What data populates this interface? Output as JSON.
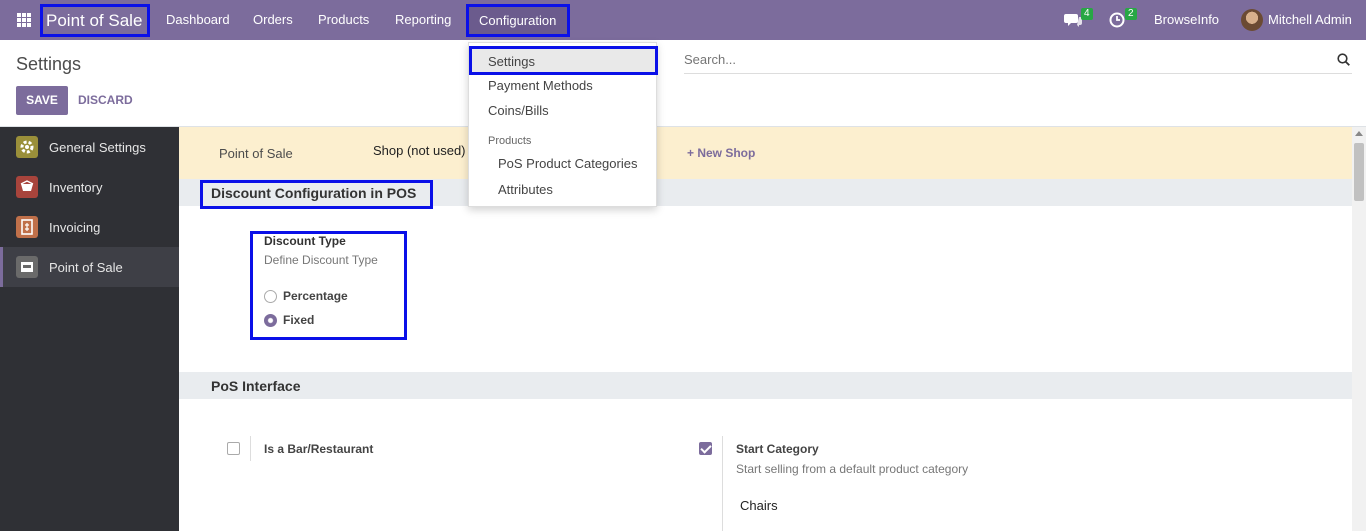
{
  "navbar": {
    "brand": "Point of Sale",
    "menu": [
      "Dashboard",
      "Orders",
      "Products",
      "Reporting"
    ],
    "active_menu": "Configuration",
    "chat_count": "4",
    "activity_count": "2",
    "company": "BrowseInfo",
    "user": "Mitchell Admin"
  },
  "control_panel": {
    "title": "Settings",
    "save_label": "SAVE",
    "discard_label": "DISCARD",
    "search_placeholder": "Search..."
  },
  "sidebar": {
    "items": [
      {
        "label": "General Settings",
        "color": "#9a8f3a"
      },
      {
        "label": "Inventory",
        "color": "#a8443c"
      },
      {
        "label": "Invoicing",
        "color": "#c0704a"
      },
      {
        "label": "Point of Sale",
        "color": "#6a6a6a"
      }
    ]
  },
  "shop_bar": {
    "label": "Point of Sale",
    "value": "Shop (not used)",
    "new_shop": "+ New Shop"
  },
  "discount_section": {
    "title": "Discount Configuration in POS",
    "field_title": "Discount Type",
    "field_desc": "Define Discount Type",
    "options": [
      "Percentage",
      "Fixed"
    ],
    "selected": "Fixed"
  },
  "interface_section": {
    "title": "PoS Interface",
    "bar_restaurant": "Is a Bar/Restaurant",
    "bar_restaurant_checked": false,
    "start_category": "Start Category",
    "start_category_checked": true,
    "start_category_desc": "Start selling from a default product category",
    "start_category_value": "Chairs"
  },
  "dropdown": {
    "settings": "Settings",
    "payment_methods": "Payment Methods",
    "coins_bills": "Coins/Bills",
    "products_header": "Products",
    "pos_product_categories": "PoS Product Categories",
    "attributes": "Attributes"
  },
  "colors": {
    "brand": "#7c6c9c",
    "highlight": "#0a10e8",
    "shop_bar": "#fcefcf"
  }
}
